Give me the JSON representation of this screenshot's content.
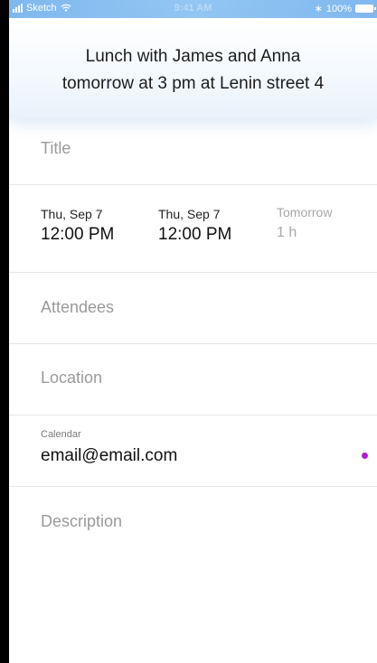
{
  "status_bar": {
    "carrier": "Sketch",
    "time": "9:41 AM",
    "battery": "100%"
  },
  "header": {
    "line1": "Lunch with James and Anna",
    "line2": "tomorrow at 3 pm at Lenin street 4"
  },
  "form": {
    "title_placeholder": "Title",
    "start": {
      "date": "Thu, Sep 7",
      "time": "12:00 PM"
    },
    "end": {
      "date": "Thu, Sep 7",
      "time": "12:00 PM"
    },
    "duration": {
      "day": "Tomorrow",
      "length": "1 h"
    },
    "attendees_placeholder": "Attendees",
    "location_placeholder": "Location",
    "calendar": {
      "label": "Calendar",
      "value": "email@email.com",
      "dot_color": "#b418d8"
    },
    "description_placeholder": "Description"
  },
  "colors": {
    "status_bar": "#8dc0f1",
    "accent_dot": "#b418d8",
    "placeholder_text": "#9a9a9a"
  }
}
